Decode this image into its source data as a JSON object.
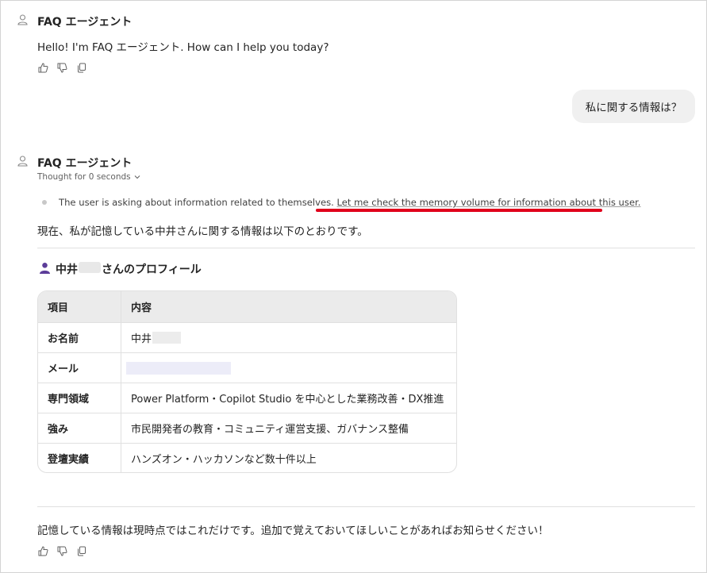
{
  "agent": {
    "name": "FAQ エージェント"
  },
  "messages": {
    "greeting": "Hello! I'm FAQ エージェント. How can I help you today?",
    "user_question": "私に関する情報は？",
    "thought_label": "Thought for 0 seconds",
    "reasoning_plain": "The user is asking about information related to themselves. ",
    "reasoning_link": "Let me check the memory volume for information about this user.",
    "intro": "現在、私が記憶している中井さんに関する情報は以下のとおりです。",
    "closing": "記憶している情報は現時点ではこれだけです。追加で覚えておいてほしいことがあればお知らせください！"
  },
  "profile": {
    "heading_prefix": "中井",
    "heading_suffix": "さんのプロフィール",
    "columns": [
      "項目",
      "内容"
    ],
    "rows": [
      {
        "key": "お名前",
        "value": "中井"
      },
      {
        "key": "メール",
        "value": ""
      },
      {
        "key": "専門領域",
        "value": "Power Platform・Copilot Studio を中心とした業務改善・DX推進"
      },
      {
        "key": "強み",
        "value": "市民開発者の教育・コミュニティ運営支援、ガバナンス整備"
      },
      {
        "key": "登壇実績",
        "value": "ハンズオン・ハッカソンなど数十件以上"
      }
    ]
  },
  "icons": {
    "agent": "agent-person-icon",
    "like": "thumbs-up-icon",
    "dislike": "thumbs-down-icon",
    "copy": "copy-icon",
    "profile": "person-icon"
  },
  "colors": {
    "annotation": "#e0001b",
    "profile_icon": "#5c3d99",
    "bubble": "#f0f0f0"
  }
}
